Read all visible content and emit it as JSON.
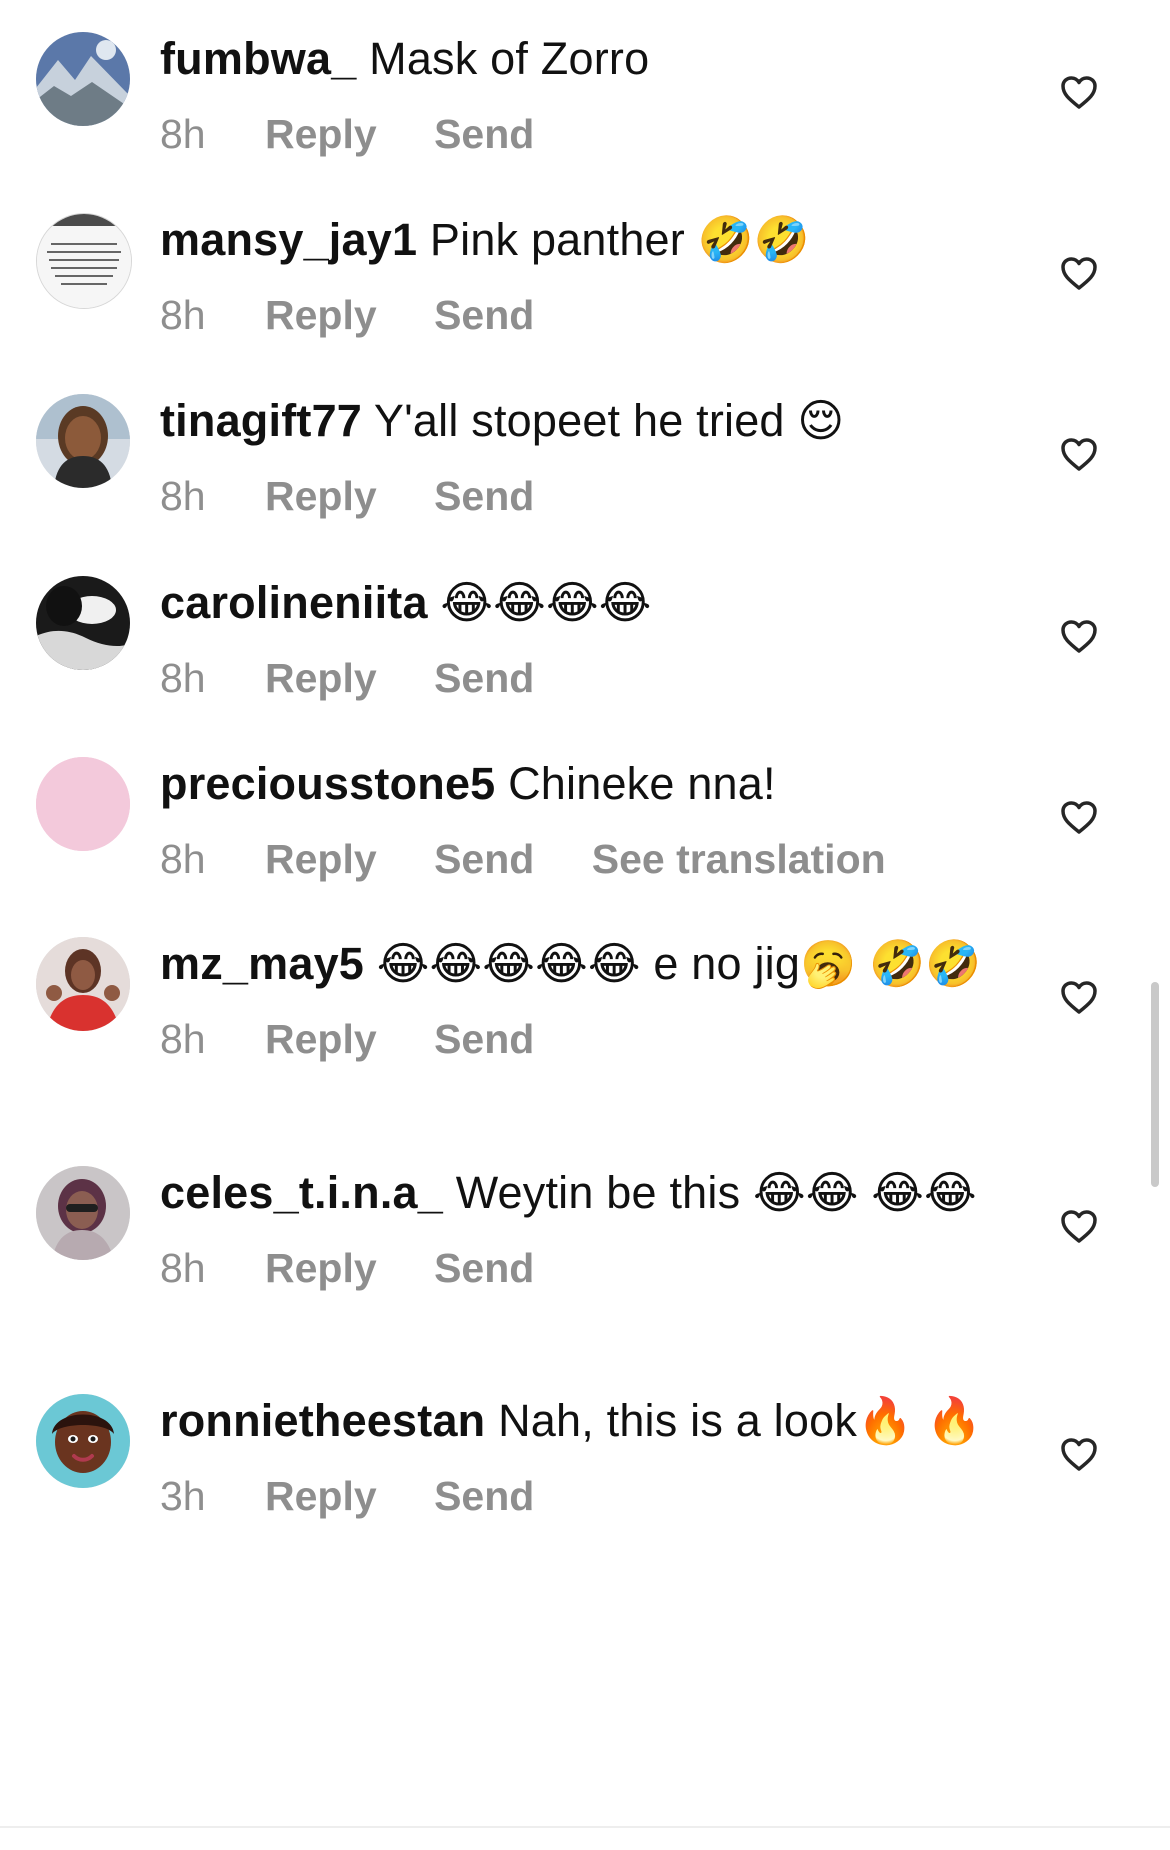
{
  "comments": [
    {
      "username": "fumbwa_",
      "text": "Mask of Zorro",
      "timestamp": "8h",
      "reply_label": "Reply",
      "send_label": "Send",
      "avatar": "mountain-landscape-avatar"
    },
    {
      "username": "mansy_jay1",
      "text": "Pink panther 🤣🤣",
      "timestamp": "8h",
      "reply_label": "Reply",
      "send_label": "Send",
      "avatar": "text-quote-avatar"
    },
    {
      "username": "tinagift77",
      "text": "Y'all stopeet he tried 😌",
      "timestamp": "8h",
      "reply_label": "Reply",
      "send_label": "Send",
      "avatar": "woman-portrait-avatar"
    },
    {
      "username": "carolineniita",
      "text": "😂😂😂😂",
      "timestamp": "8h",
      "reply_label": "Reply",
      "send_label": "Send",
      "avatar": "dark-photo-avatar"
    },
    {
      "username": "preciousstone5",
      "text": "Chineke nna!",
      "timestamp": "8h",
      "reply_label": "Reply",
      "send_label": "Send",
      "translation_label": "See translation",
      "avatar": "plain-pink-avatar"
    },
    {
      "username": "mz_may5",
      "text": "😂😂😂😂😂 e no jig🥱 🤣🤣",
      "timestamp": "8h",
      "reply_label": "Reply",
      "send_label": "Send",
      "avatar": "red-shirt-avatar"
    },
    {
      "username": "celes_t.i.n.a_",
      "text": "Weytin be this 😂😂 😂😂",
      "timestamp": "8h",
      "reply_label": "Reply",
      "send_label": "Send",
      "avatar": "selfie-avatar"
    },
    {
      "username": "ronnietheestan",
      "text": "Nah, this is a look🔥 🔥",
      "timestamp": "3h",
      "reply_label": "Reply",
      "send_label": "Send",
      "avatar": "cartoon-face-avatar"
    }
  ],
  "icons": {
    "like": "heart-outline-icon"
  },
  "colors": {
    "text": "#111111",
    "meta": "#8e8e8e",
    "background": "#ffffff",
    "scrollbar": "#c9c9c9"
  }
}
